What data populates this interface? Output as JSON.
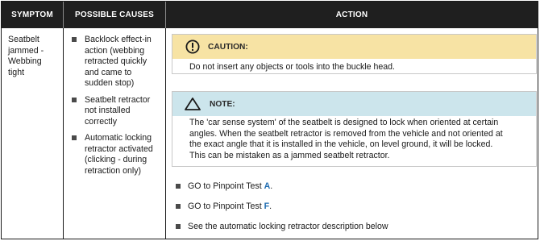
{
  "header": {
    "symptom": "SYMPTOM",
    "possible_causes": "POSSIBLE CAUSES",
    "action": "ACTION"
  },
  "symptom_text": "Seatbelt jammed - Webbing tight",
  "causes": [
    "Backlock effect-in action (webbing retracted quickly and came to sudden stop)",
    "Seatbelt retractor not installed correctly",
    "Automatic locking retractor activated (clicking - during retraction only)"
  ],
  "caution": {
    "icon": "exclamation-circle-icon",
    "label": "CAUTION:",
    "text": "Do not insert any objects or tools into the buckle head.",
    "color": "#f7e3a4"
  },
  "note": {
    "icon": "warning-triangle-icon",
    "label": "NOTE:",
    "lines": [
      "The 'car sense system' of the seatbelt is designed to lock when oriented at certain",
      "angles. When the seatbelt retractor is removed from the vehicle and not oriented at",
      "the exact angle that it is installed in the vehicle, on level ground, it will be locked.",
      "This can be mistaken as a jammed seatbelt retractor."
    ],
    "color": "#cce5ec"
  },
  "actions": [
    {
      "prefix": "GO to Pinpoint Test ",
      "link": "A",
      "suffix": "."
    },
    {
      "prefix": "GO to Pinpoint Test ",
      "link": "F",
      "suffix": "."
    },
    {
      "prefix": "See the automatic locking retractor description below",
      "link": "",
      "suffix": ""
    }
  ],
  "colors": {
    "header_bg": "#1f1f1f",
    "link": "#1e6bb0"
  }
}
